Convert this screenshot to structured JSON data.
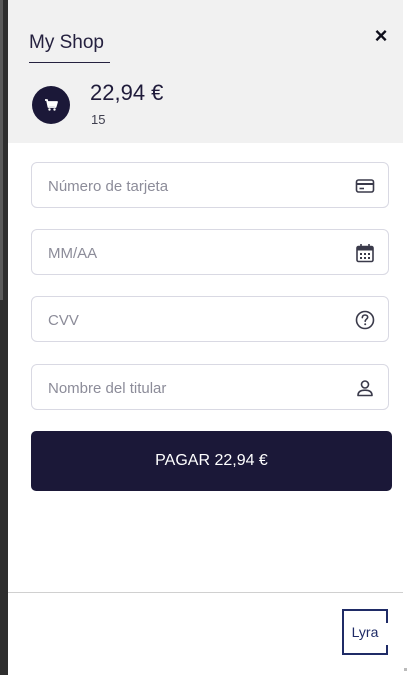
{
  "header": {
    "shop_name": "My Shop",
    "close_symbol": "×",
    "cart_icon": "cart-icon",
    "amount": "22,94 €",
    "items_count": "15"
  },
  "form": {
    "card_number": {
      "placeholder": "Número de tarjeta",
      "icon": "credit-card-icon"
    },
    "expiry": {
      "placeholder": "MM/AA",
      "icon": "calendar-icon"
    },
    "cvv": {
      "placeholder": "CVV",
      "icon": "help-circle-icon"
    },
    "holder": {
      "placeholder": "Nombre del titular",
      "icon": "user-icon"
    },
    "pay_label": "PAGAR 22,94 €"
  },
  "footer": {
    "logo_text": "Lyra"
  },
  "colors": {
    "brand_dark": "#1b1838",
    "header_bg": "#f1f1f1",
    "border": "#d9d9e3"
  }
}
